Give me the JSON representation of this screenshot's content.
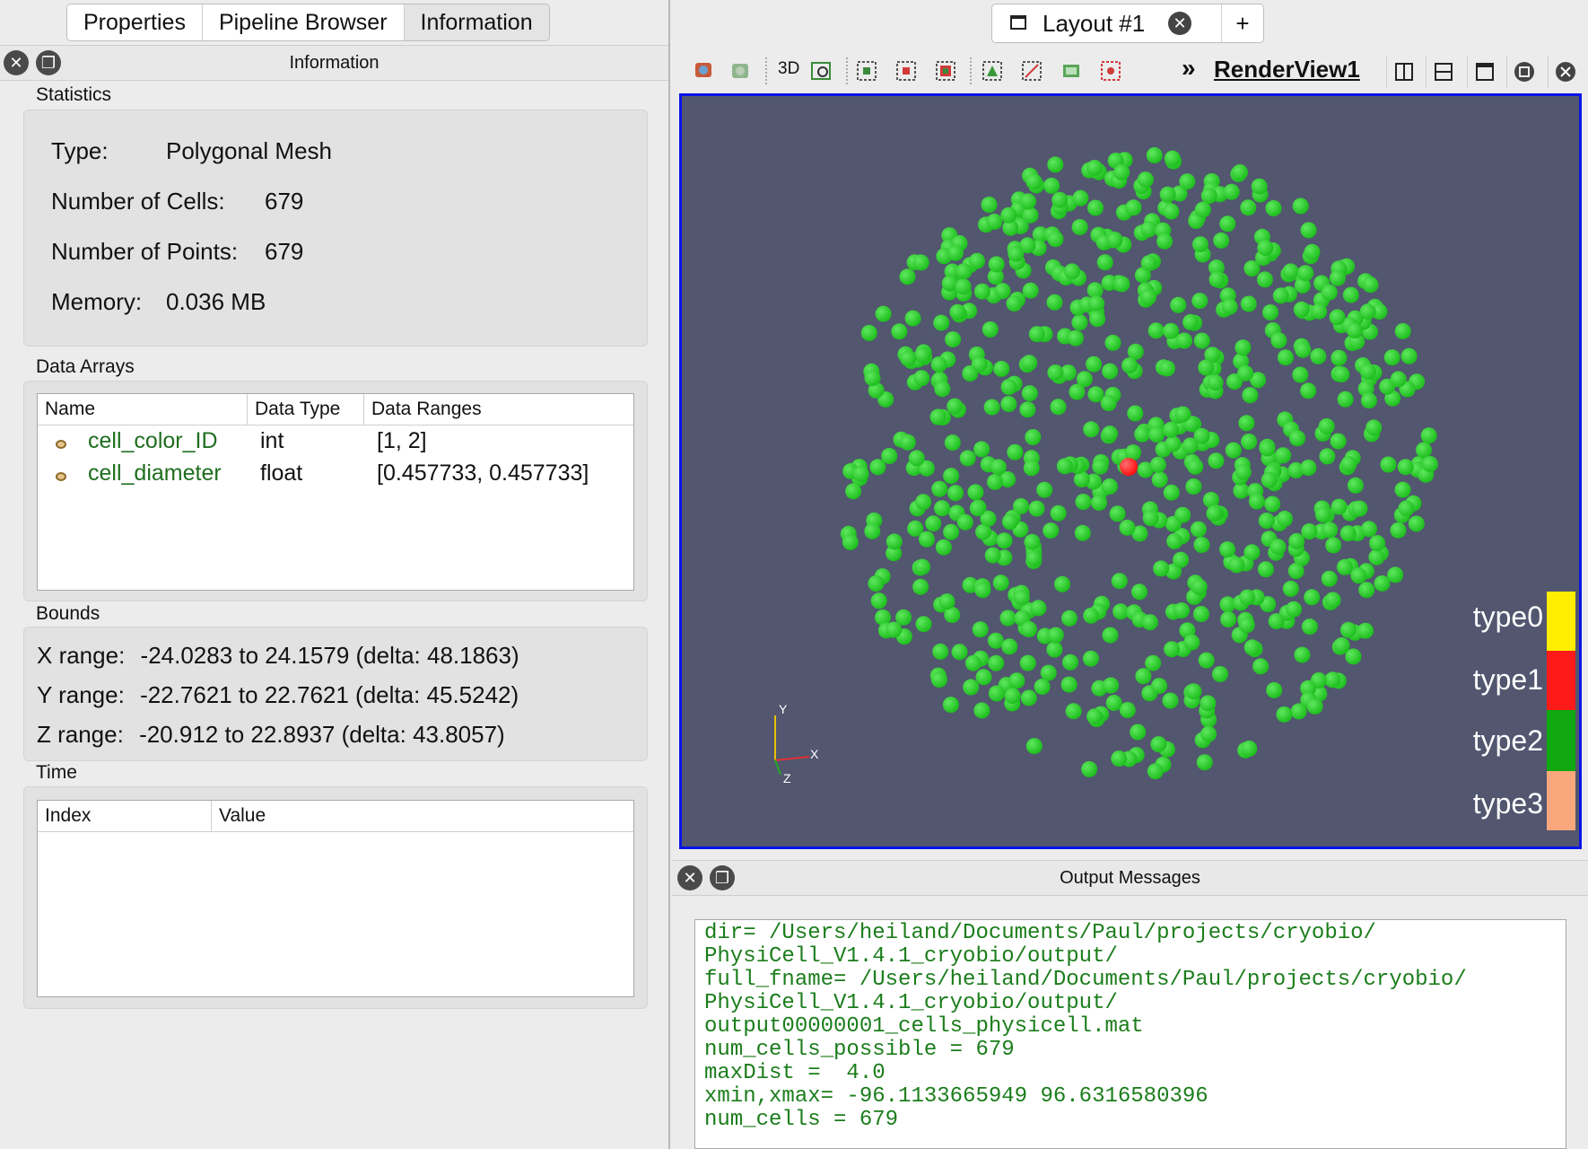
{
  "left_tabs": [
    "Properties",
    "Pipeline Browser",
    "Information"
  ],
  "info_panel": {
    "title": "Information"
  },
  "statistics": {
    "label": "Statistics",
    "type_label": "Type:",
    "type_value": "Polygonal Mesh",
    "cells_label": "Number of Cells:",
    "cells_value": "679",
    "points_label": "Number of Points:",
    "points_value": "679",
    "memory_label": "Memory:",
    "memory_value": "0.036 MB"
  },
  "data_arrays": {
    "label": "Data Arrays",
    "columns": [
      "Name",
      "Data Type",
      "Data Ranges"
    ],
    "rows": [
      {
        "name": "cell_color_ID",
        "type": "int",
        "range": "[1, 2]"
      },
      {
        "name": "cell_diameter",
        "type": "float",
        "range": "[0.457733, 0.457733]"
      }
    ]
  },
  "bounds": {
    "label": "Bounds",
    "rows": [
      {
        "axis": "X range:",
        "value": "-24.0283 to 24.1579 (delta: 48.1863)"
      },
      {
        "axis": "Y range:",
        "value": "-22.7621 to 22.7621 (delta: 45.5242)"
      },
      {
        "axis": "Z range:",
        "value": "-20.912 to 22.8937 (delta: 43.8057)"
      }
    ]
  },
  "time": {
    "label": "Time",
    "columns": [
      "Index",
      "Value"
    ]
  },
  "layout": {
    "tab_label": "Layout #1",
    "add_label": "+"
  },
  "render_view": {
    "label": "RenderView1",
    "toolbar_3d": "3D",
    "background": "#52566f",
    "cell_color": "#1fbf1f",
    "highlight_color": "#ff1010",
    "axes": {
      "x": "X",
      "y": "Y",
      "z": "Z"
    },
    "legend": [
      {
        "label": "type0",
        "color": "#ffee00"
      },
      {
        "label": "type1",
        "color": "#ff1a1a"
      },
      {
        "label": "type2",
        "color": "#10a810"
      },
      {
        "label": "type3",
        "color": "#f9a77c"
      }
    ]
  },
  "output": {
    "title": "Output Messages",
    "lines": [
      "dir= /Users/heiland/Documents/Paul/projects/cryobio/",
      "PhysiCell_V1.4.1_cryobio/output/",
      "full_fname= /Users/heiland/Documents/Paul/projects/cryobio/",
      "PhysiCell_V1.4.1_cryobio/output/",
      "output00000001_cells_physicell.mat",
      "num_cells_possible = 679",
      "maxDist =  4.0",
      "xmin,xmax= -96.1133665949 96.6316580396",
      "num_cells = 679"
    ]
  }
}
